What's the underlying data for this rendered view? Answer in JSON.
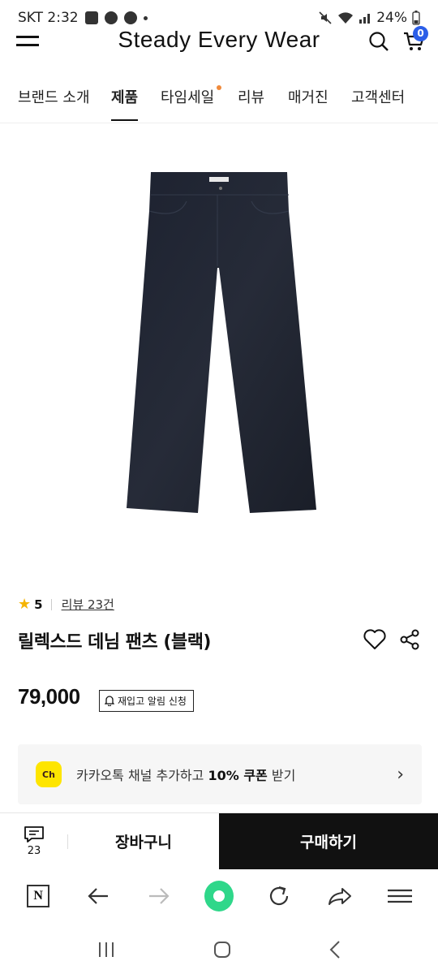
{
  "status_bar": {
    "carrier_time": "SKT 2:32",
    "battery": "24%"
  },
  "header": {
    "brand": "Steady Every Wear",
    "cart_count": "0"
  },
  "nav": {
    "items": [
      {
        "label": "브랜드 소개"
      },
      {
        "label": "제품"
      },
      {
        "label": "타임세일"
      },
      {
        "label": "리뷰"
      },
      {
        "label": "매거진"
      },
      {
        "label": "고객센터"
      }
    ]
  },
  "product": {
    "rating": "5",
    "reviews_link": "리뷰 23건",
    "title": "릴렉스드 데님 팬츠 (블랙)",
    "price": "79,000",
    "restock_label": "재입고 알림 신청"
  },
  "kakao_banner": {
    "logo": "Ch",
    "text_prefix": "카카오톡 채널 추가하고 ",
    "text_bold": "10% 쿠폰",
    "text_suffix": " 받기"
  },
  "bottom_bar": {
    "chat_count": "23",
    "cart_label": "장바구니",
    "buy_label": "구매하기"
  },
  "browser_bar": {
    "n_label": "N"
  },
  "colors": {
    "accent": "#2b5ee8",
    "kakao_yellow": "#fee500",
    "buy_bg": "#111111",
    "timesale_dot": "#f08a3b",
    "browser_green": "#2fd78a"
  },
  "icons": [
    "menu-icon",
    "search-icon",
    "cart-icon",
    "star-icon",
    "heart-icon",
    "share-icon",
    "bell-icon",
    "chevron-right-icon",
    "chat-icon",
    "back-arrow-icon",
    "forward-arrow-icon",
    "refresh-icon",
    "share-arrow-icon",
    "hamburger-icon"
  ]
}
